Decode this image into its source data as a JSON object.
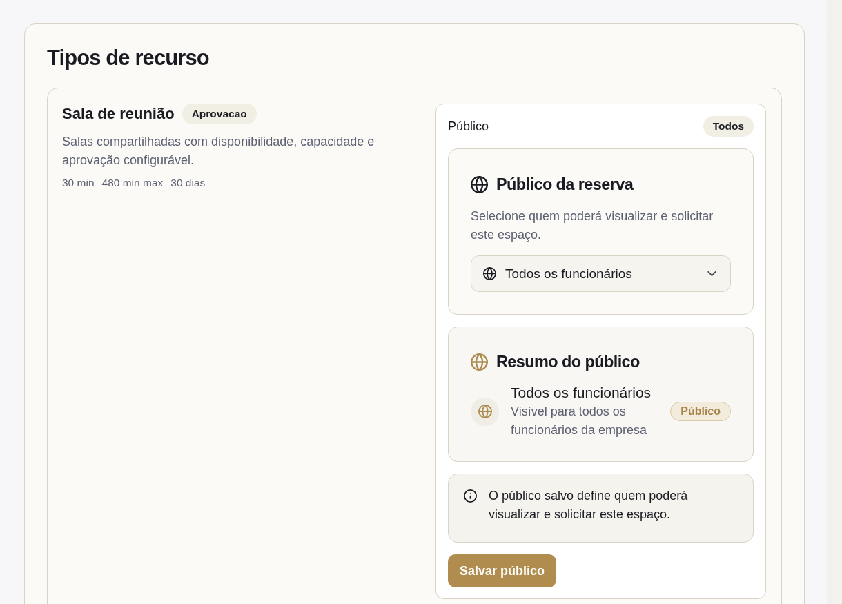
{
  "page": {
    "title": "Tipos de recurso"
  },
  "resource_types": [
    {
      "name": "Sala de reunião",
      "badge": "Aprovacao",
      "description": "Salas compartilhadas com disponibilidade, capacidade e aprovação configurável.",
      "meta": [
        "30 min",
        "480 min max",
        "30 dias"
      ],
      "audience_panel": {
        "title": "Público",
        "badge": "Todos",
        "selection": {
          "title": "Público da reserva",
          "description": "Selecione quem poderá visualizar e solicitar este espaço.",
          "select": {
            "value": "Todos os funcionários"
          }
        },
        "summary": {
          "title": "Resumo do público",
          "item": {
            "title": "Todos os funcionários",
            "description": "Visível para todos os funcionários da empresa",
            "badge": "Público"
          }
        },
        "note": "O público salvo define quem poderá visualizar e solicitar este espaço.",
        "save_button": "Salvar público"
      }
    }
  ]
}
